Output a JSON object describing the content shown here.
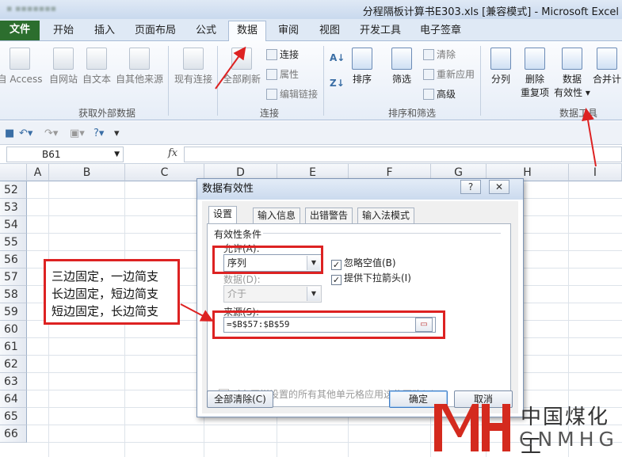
{
  "window": {
    "title": "分程隔板计算书E303.xls  [兼容模式] - Microsoft Excel"
  },
  "ribbon_tabs": [
    {
      "label": "文件"
    },
    {
      "label": "开始"
    },
    {
      "label": "插入"
    },
    {
      "label": "页面布局"
    },
    {
      "label": "公式"
    },
    {
      "label": "数据"
    },
    {
      "label": "审阅"
    },
    {
      "label": "视图"
    },
    {
      "label": "开发工具"
    },
    {
      "label": "电子签章"
    }
  ],
  "ribbon": {
    "get_external": {
      "access": "自 Access",
      "web": "自网站",
      "text": "自文本",
      "other": "自其他来源",
      "label": "获取外部数据"
    },
    "existing": "现有连接",
    "refresh_all": "全部刷新",
    "connections": {
      "connections": "连接",
      "properties": "属性",
      "edit_links": "编辑链接",
      "label": "连接"
    },
    "sort_filter": {
      "sort": "排序",
      "filter": "筛选",
      "clear": "清除",
      "reapply": "重新应用",
      "advanced": "高级",
      "label": "排序和筛选"
    },
    "data_tools": {
      "split": "分列",
      "remove_dup_1": "删除",
      "remove_dup_2": "重复项",
      "validation_1": "数据",
      "validation_2": "有效性",
      "consolidate": "合并计",
      "label": "数据工具"
    }
  },
  "formula_bar": {
    "name_box": "B61",
    "fx": "fx",
    "formula": ""
  },
  "grid": {
    "columns": [
      "A",
      "B",
      "C",
      "D",
      "E",
      "F",
      "G",
      "H",
      "I"
    ],
    "rows": [
      "52",
      "53",
      "54",
      "55",
      "56",
      "57",
      "58",
      "59",
      "60",
      "61",
      "62",
      "63",
      "64",
      "65",
      "66"
    ]
  },
  "annotation": {
    "lines": [
      "三边固定，一边简支",
      "长边固定，短边简支",
      "短边固定，长边简支"
    ]
  },
  "dialog": {
    "title": "数据有效性",
    "help": "?",
    "close": "✕",
    "tabs": [
      "设置",
      "输入信息",
      "出错警告",
      "输入法模式"
    ],
    "section": "有效性条件",
    "allow_label": "允许(A):",
    "allow_value": "序列",
    "data_label": "数据(D):",
    "data_value": "介于",
    "ignore_blank": "忽略空值(B)",
    "dropdown": "提供下拉箭头(I)",
    "source_label": "来源(S):",
    "source_value": "=$B$57:$B$59",
    "apply_all": "对有同样设置的所有其他单元格应用这些更改(P)",
    "clear_all": "全部清除(C)",
    "ok": "确定",
    "cancel": "取消"
  },
  "watermark": {
    "cn": "中国煤化工",
    "en": "CNMHG"
  },
  "colors": {
    "annotation_red": "#dd2222",
    "file_tab": "#2c6e2e"
  }
}
